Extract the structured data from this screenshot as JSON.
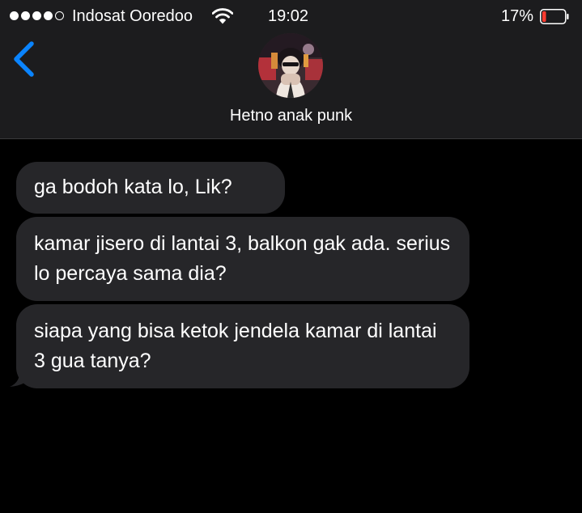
{
  "status_bar": {
    "signal_bars_filled": 4,
    "signal_bars_total": 5,
    "carrier": "Indosat Ooredoo",
    "wifi_icon": "wifi-icon",
    "time": "19:02",
    "battery_percent_text": "17%",
    "battery_level": 0.17,
    "battery_color": "#ff3b30"
  },
  "header": {
    "back_icon": "chevron-left-icon",
    "contact_name": "Hetno anak punk",
    "accent_color": "#0a84ff"
  },
  "messages": [
    {
      "direction": "incoming",
      "text": "ga bodoh kata lo, Lik?"
    },
    {
      "direction": "incoming",
      "text": "kamar jisero di lantai 3, balkon gak ada. serius lo percaya sama dia?"
    },
    {
      "direction": "incoming",
      "text": "siapa yang bisa ketok jendela kamar di lantai 3 gua tanya?"
    }
  ]
}
